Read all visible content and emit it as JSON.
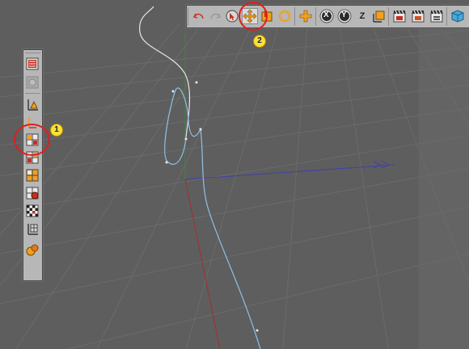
{
  "top_toolbar": {
    "undo_icon": "undo-icon",
    "redo_icon": "redo-icon",
    "live_selection_icon": "live-selection-icon",
    "move_icon": "move-icon",
    "scale_icon": "scale-icon",
    "rotate_icon": "rotate-icon",
    "add_icon": "add-icon",
    "x_axis_label": "X",
    "y_axis_label": "Y",
    "z_axis_label": "Z",
    "coord_system_icon": "coordinate-system-icon",
    "render_view_icon": "render-view-icon",
    "render_picture_icon": "render-picture-viewer-icon",
    "render_settings_icon": "render-settings-icon",
    "cube_icon": "cube-icon"
  },
  "left_toolbar": {
    "tools": [
      "make-editable-icon",
      "model-mode-icon",
      "object-axis-icon",
      "points-mode-icon",
      "edges-mode-icon",
      "polygons-mode-icon",
      "uvw-icon",
      "texture-icon",
      "workplane-icon",
      "snap-icon"
    ]
  },
  "annotations": {
    "badge_1": "1",
    "badge_2": "2"
  },
  "colors": {
    "viewport_bg": "#5e5e5e",
    "grid_line": "#6a6a6a",
    "x_axis": "#4040b0",
    "y_axis": "#3a8a3a",
    "z_axis": "#a03030",
    "spline": "#8fc0e6",
    "spline_top": "#e6e6e6",
    "callout": "#e01e1e",
    "badge": "#f7e13a"
  }
}
